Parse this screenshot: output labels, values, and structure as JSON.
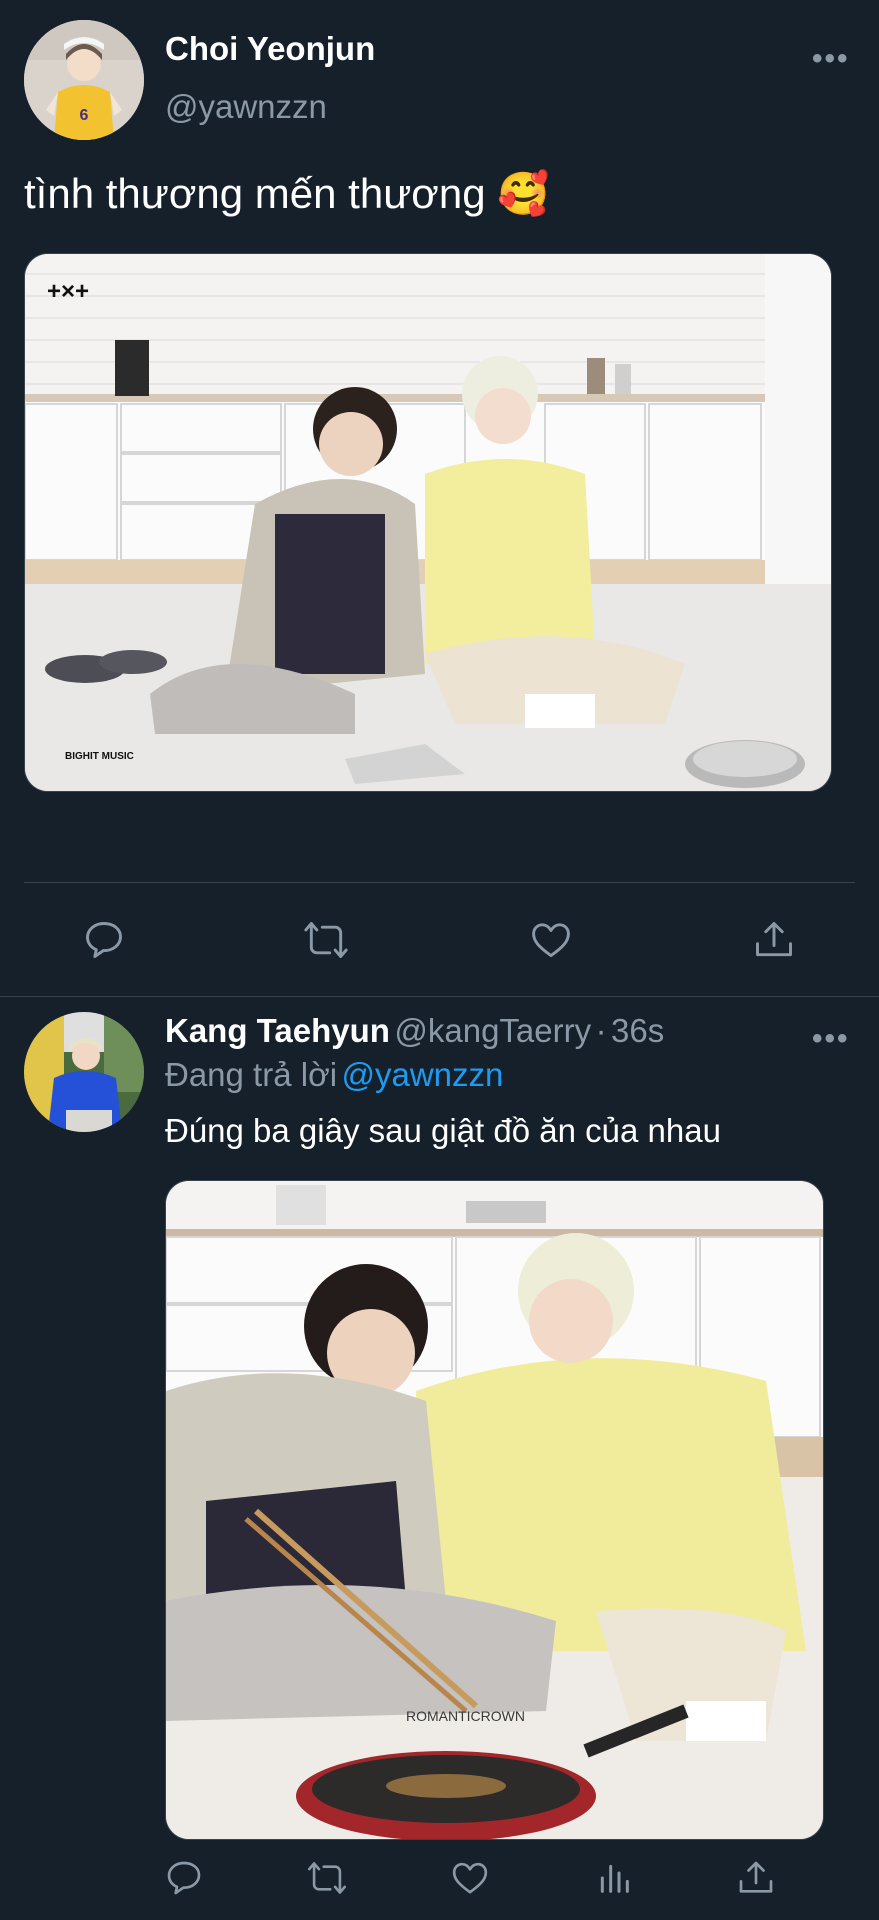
{
  "tweet1": {
    "author_name": "Choi Yeonjun",
    "author_handle": "@yawnzzn",
    "text": "tình thương mến thương",
    "emoji": "🥰",
    "media_watermark_top": "+×+",
    "media_watermark_bottom": "BIGHIT MUSIC",
    "more_label": "•••"
  },
  "tweet2": {
    "author_name": "Kang Taehyun",
    "author_handle": "@kangTaerry",
    "separator": "·",
    "time": "36s",
    "replying_prefix": "Đang trả lời",
    "replying_to": "@yawnzzn",
    "text": "Đúng ba giây sau giật đồ ăn của nhau",
    "more_label": "•••",
    "sweatshirt_text": "ROMANTICROWN"
  },
  "icons": {
    "reply": "reply-icon",
    "retweet": "retweet-icon",
    "like": "heart-icon",
    "share": "share-icon",
    "analytics": "analytics-icon"
  },
  "colors": {
    "background": "#15202b",
    "divider": "#38444d",
    "secondary_text": "#8b98a5",
    "link": "#1d9bf0"
  }
}
